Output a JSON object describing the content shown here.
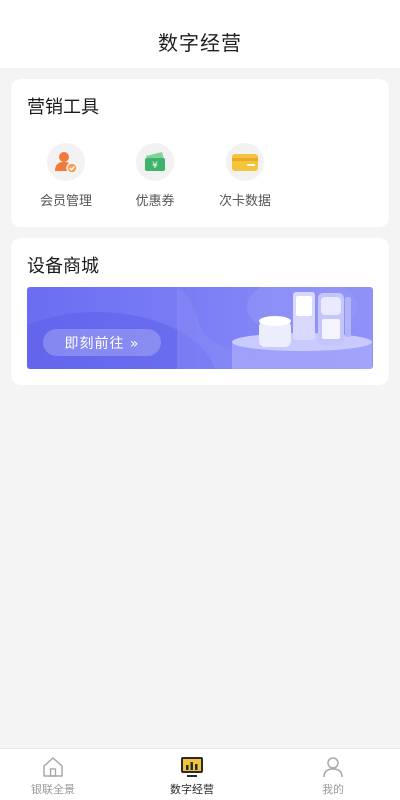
{
  "header": {
    "title": "数字经营"
  },
  "marketing": {
    "title": "营销工具",
    "items": [
      {
        "label": "会员管理",
        "icon": "member-icon"
      },
      {
        "label": "优惠券",
        "icon": "coupon-icon"
      },
      {
        "label": "次卡数据",
        "icon": "card-icon"
      }
    ]
  },
  "mall": {
    "title": "设备商城",
    "banner_button": "即刻前往 »"
  },
  "tabbar": {
    "items": [
      {
        "label": "银联全景",
        "icon": "home-icon",
        "active": false
      },
      {
        "label": "数字经营",
        "icon": "chart-icon",
        "active": true
      },
      {
        "label": "我的",
        "icon": "user-icon",
        "active": false
      }
    ]
  },
  "colors": {
    "banner": "#6a6df2",
    "member_icon": "#f07a3a",
    "coupon_icon": "#3fb36a",
    "card_icon": "#f5c43a",
    "tab_active": "#2a2a2a",
    "tab_inactive": "#9a9a9a"
  }
}
